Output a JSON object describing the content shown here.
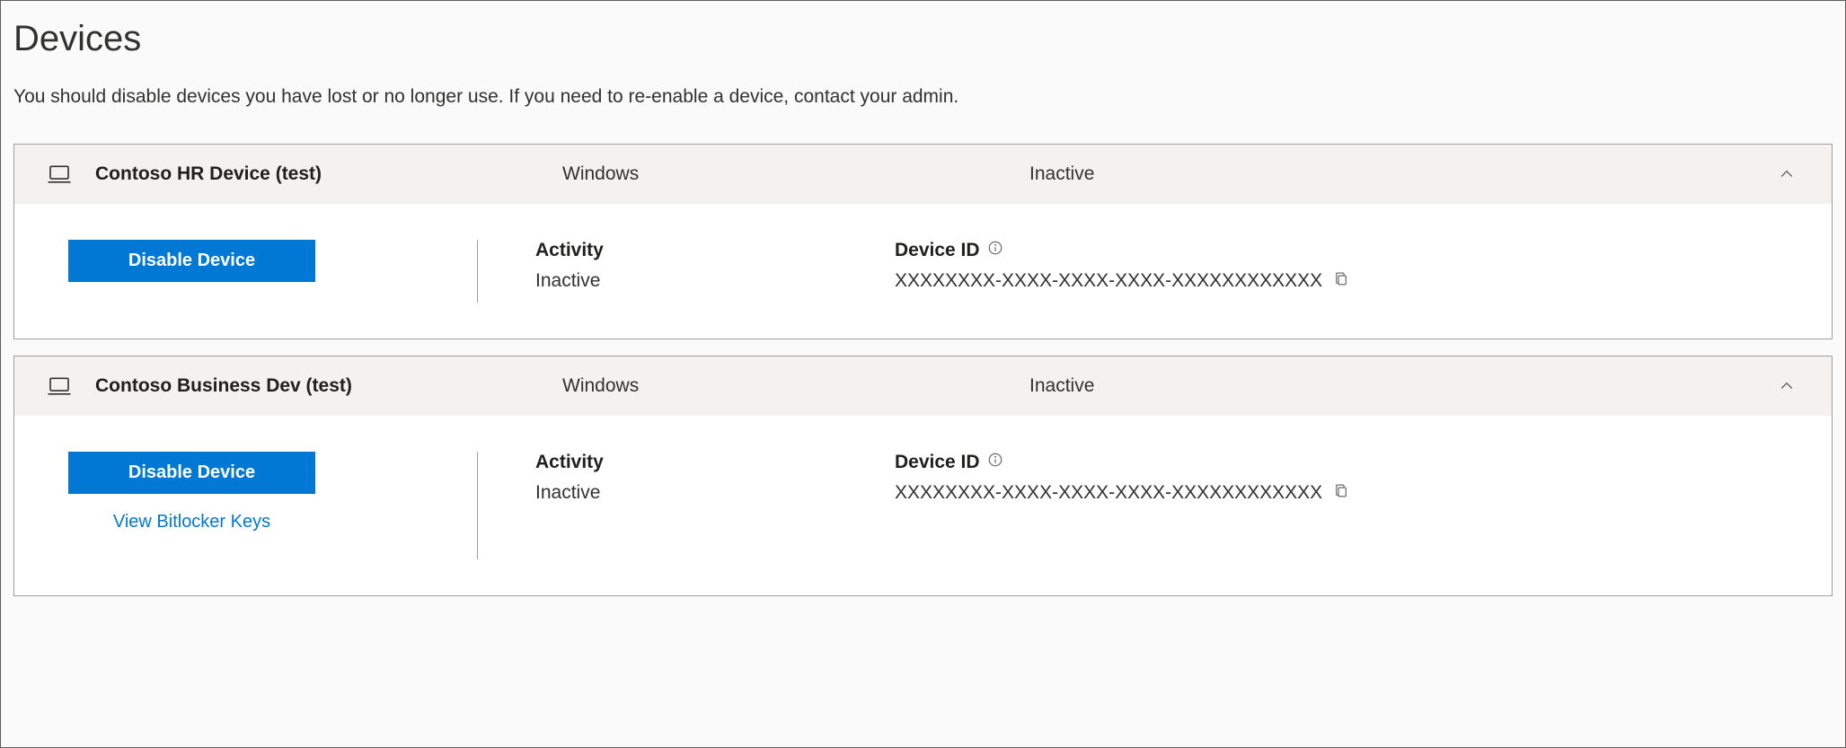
{
  "page": {
    "title": "Devices",
    "subtitle": "You should disable devices you have lost or no longer use. If you need to re-enable a device, contact your admin."
  },
  "labels": {
    "activity": "Activity",
    "device_id": "Device ID",
    "disable_device": "Disable Device",
    "view_bitlocker": "View Bitlocker Keys"
  },
  "devices": [
    {
      "name": "Contoso HR Device (test)",
      "os": "Windows",
      "status": "Inactive",
      "activity": "Inactive",
      "device_id": "XXXXXXXX-XXXX-XXXX-XXXX-XXXXXXXXXXXX",
      "show_bitlocker": false
    },
    {
      "name": "Contoso Business Dev (test)",
      "os": "Windows",
      "status": "Inactive",
      "activity": "Inactive",
      "device_id": "XXXXXXXX-XXXX-XXXX-XXXX-XXXXXXXXXXXX",
      "show_bitlocker": true
    }
  ]
}
